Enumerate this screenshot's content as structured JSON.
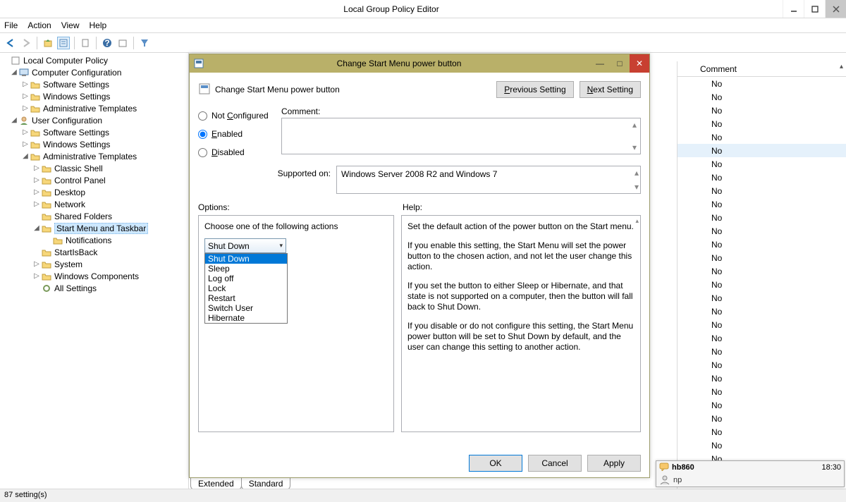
{
  "window": {
    "title": "Local Group Policy Editor"
  },
  "menu": {
    "file": "File",
    "action": "Action",
    "view": "View",
    "help": "Help"
  },
  "tree": {
    "root": "Local Computer Policy",
    "cc": "Computer Configuration",
    "cc_sw": "Software Settings",
    "cc_win": "Windows Settings",
    "cc_adm": "Administrative Templates",
    "uc": "User Configuration",
    "uc_sw": "Software Settings",
    "uc_win": "Windows Settings",
    "uc_adm": "Administrative Templates",
    "classic": "Classic Shell",
    "cpanel": "Control Panel",
    "desktop": "Desktop",
    "network": "Network",
    "shared": "Shared Folders",
    "startmenu": "Start Menu and Taskbar",
    "notif": "Notifications",
    "startisback": "StartIsBack",
    "system": "System",
    "wincomp": "Windows Components",
    "allset": "All Settings"
  },
  "right_col": {
    "header": "Comment",
    "rows": [
      "No",
      "No",
      "No",
      "No",
      "No",
      "No",
      "No",
      "No",
      "No",
      "No",
      "No",
      "No",
      "No",
      "No",
      "No",
      "No",
      "No",
      "No",
      "No",
      "No",
      "No",
      "No",
      "No",
      "No",
      "No",
      "No",
      "No",
      "No",
      "No"
    ],
    "highlight_index": 5
  },
  "dialog": {
    "title": "Change Start Menu power button",
    "setting_name": "Change Start Menu power button",
    "prev": "Previous Setting",
    "next": "Next Setting",
    "not_configured": "Not Configured",
    "enabled": "Enabled",
    "disabled": "Disabled",
    "state": "enabled",
    "comment_label": "Comment:",
    "supported_label": "Supported on:",
    "supported_text": "Windows Server 2008 R2 and Windows 7",
    "options_label": "Options:",
    "help_label": "Help:",
    "option_prompt": "Choose one of the following actions",
    "combo_value": "Shut Down",
    "combo_options": [
      "Shut Down",
      "Sleep",
      "Log off",
      "Lock",
      "Restart",
      "Switch User",
      "Hibernate"
    ],
    "help_p1": "Set the default action of the power button on the Start menu.",
    "help_p2": "If you enable this setting, the Start Menu will set the power button to the chosen action, and not let the user change this action.",
    "help_p3": "If you set the button to either Sleep or Hibernate, and that state is not supported on a computer, then the button will fall back to Shut Down.",
    "help_p4": "If you disable or do not configure this setting, the Start Menu power button will be set to Shut Down by default, and the user can change this setting to another action.",
    "ok": "OK",
    "cancel": "Cancel",
    "apply": "Apply"
  },
  "tabs": {
    "extended": "Extended",
    "standard": "Standard"
  },
  "status": "87 setting(s)",
  "notif": {
    "user": "hb860",
    "time": "18:30",
    "msg": "np"
  }
}
